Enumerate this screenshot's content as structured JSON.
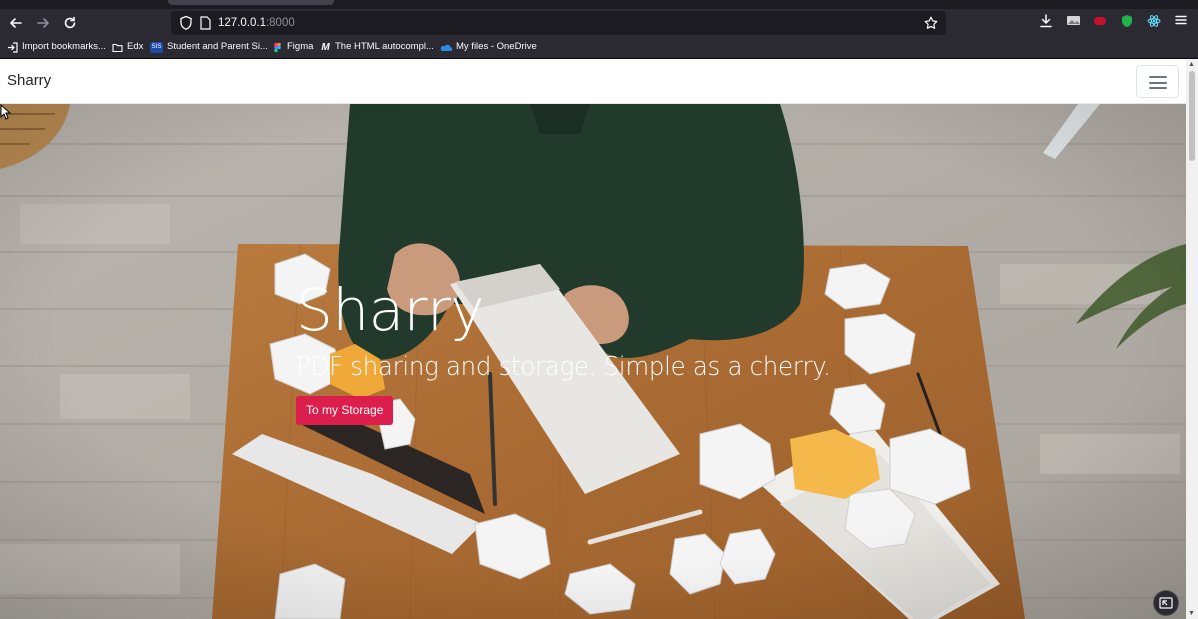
{
  "browser": {
    "url_host": "127.0.0.1",
    "url_port": ":8000",
    "nav": {
      "back_icon": "arrow-left-icon",
      "forward_icon": "arrow-right-icon",
      "reload_icon": "reload-icon"
    },
    "bookmarks": [
      {
        "label": "Import bookmarks...",
        "icon": "import-icon"
      },
      {
        "label": "Edx",
        "icon": "folder-icon"
      },
      {
        "label": "Student and Parent Si...",
        "icon": "sis-icon",
        "badge": "SIS"
      },
      {
        "label": "Figma",
        "icon": "figma-icon"
      },
      {
        "label": "The HTML autocompl...",
        "icon": "m-icon",
        "badge": "M"
      },
      {
        "label": "My files - OneDrive",
        "icon": "onedrive-icon"
      }
    ]
  },
  "page": {
    "brand": "Sharry",
    "hero": {
      "title": "Sharry",
      "subtitle": "PDF sharing and storage. Simple as a cherry.",
      "cta_label": "To my Storage"
    }
  },
  "colors": {
    "accent": "#dc1e4d",
    "chrome_dark": "#2b2a33",
    "chrome_darker": "#1c1b22"
  }
}
